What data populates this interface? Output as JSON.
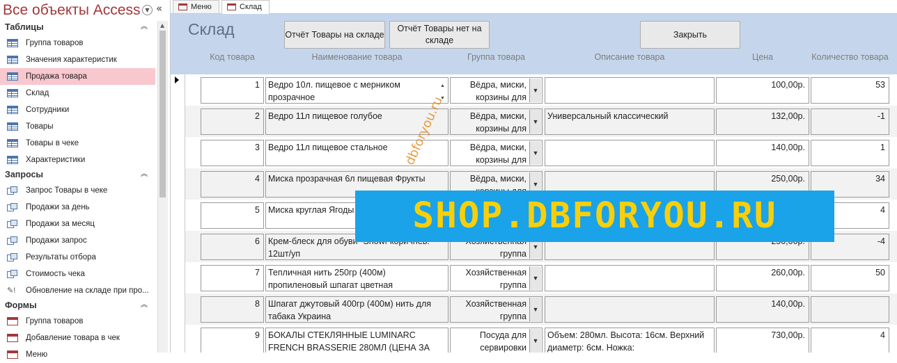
{
  "nav": {
    "title": "Все объекты Access",
    "sections": [
      {
        "label": "Таблицы",
        "kind": "table",
        "items": [
          {
            "label": "Группа товаров"
          },
          {
            "label": "Значения характеристик"
          },
          {
            "label": "Продажа товара",
            "selected": true
          },
          {
            "label": "Склад"
          },
          {
            "label": "Сотрудники"
          },
          {
            "label": "Товары"
          },
          {
            "label": "Товары в чеке"
          },
          {
            "label": "Характеристики"
          }
        ]
      },
      {
        "label": "Запросы",
        "kind": "query",
        "items": [
          {
            "label": "Запрос Товары в чеке"
          },
          {
            "label": "Продажи за день"
          },
          {
            "label": "Продажи за месяц"
          },
          {
            "label": "Продажи запрос"
          },
          {
            "label": "Результаты отбора"
          },
          {
            "label": "Стоимость чека"
          },
          {
            "label": "Обновление на складе при про...",
            "kind": "update"
          }
        ]
      },
      {
        "label": "Формы",
        "kind": "form",
        "items": [
          {
            "label": "Группа товаров"
          },
          {
            "label": "Добавление товара в чек"
          },
          {
            "label": "Меню"
          }
        ]
      }
    ]
  },
  "tabs": [
    {
      "label": "Меню",
      "active": false
    },
    {
      "label": "Склад",
      "active": true
    }
  ],
  "form": {
    "title": "Склад",
    "buttons": {
      "report_in_stock": "Отчёт Товары на складе",
      "report_not_in_stock": "Отчёт Товары нет на складе",
      "close": "Закрыть"
    },
    "columns": {
      "code": "Код товара",
      "name": "Наименование товара",
      "group": "Группа товара",
      "descr": "Описание товара",
      "price": "Цена",
      "qty": "Количество товара"
    },
    "rows": [
      {
        "code": "1",
        "name": "Ведро 10л. пищевое с мерником прозрачное",
        "group": "Вёдра, миски, корзины для",
        "descr": "",
        "price": "100,00р.",
        "qty": "53",
        "current": true
      },
      {
        "code": "2",
        "name": "Ведро 11л пищевое голубое",
        "group": "Вёдра, миски, корзины для",
        "descr": "Универсальный классический",
        "price": "132,00р.",
        "qty": "-1"
      },
      {
        "code": "3",
        "name": "Ведро 11л пищевое стальное",
        "group": "Вёдра, миски, корзины для",
        "descr": "",
        "price": "140,00р.",
        "qty": "1"
      },
      {
        "code": "4",
        "name": "Миска прозрачная 6л пищевая Фрукты",
        "group": "Вёдра, миски, корзины для",
        "descr": "",
        "price": "250,00р.",
        "qty": "34"
      },
      {
        "code": "5",
        "name": "Миска круглая Ягоды",
        "group": "",
        "descr": "",
        "price": "",
        "qty": "4"
      },
      {
        "code": "6",
        "name": "Крем-блеск для обуви \"Showl\"коричнев. 12шт/уп",
        "group": "Хозяйственная группа",
        "descr": "",
        "price": "250,00р.",
        "qty": "-4"
      },
      {
        "code": "7",
        "name": "Тепличная нить 250гр (400м) пропиленовый шпагат цветная",
        "group": "Хозяйственная группа",
        "descr": "",
        "price": "260,00р.",
        "qty": "50"
      },
      {
        "code": "8",
        "name": "Шпагат джутовый 400гр (400м) нить для табака Украина",
        "group": "Хозяйственная группа",
        "descr": "",
        "price": "140,00р.",
        "qty": ""
      },
      {
        "code": "9",
        "name": "БОКАЛЫ СТЕКЛЯННЫЕ LUMINARC FRENCH BRASSERIE 280МЛ (ЦЕНА ЗА",
        "group": "Посуда для сервировки",
        "descr": "Объем: 280мл. Высота: 16см. Верхний диаметр: 6см. Ножка:",
        "price": "730,00р.",
        "qty": "4"
      }
    ]
  },
  "watermark": {
    "banner": "SHOP.DBFORYOU.RU",
    "diagonal": "dbforyou.ru"
  }
}
